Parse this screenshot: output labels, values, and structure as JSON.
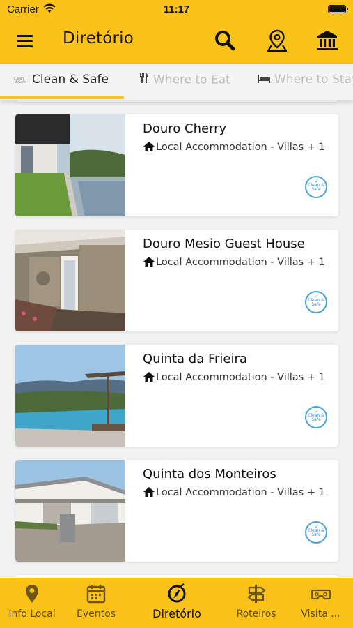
{
  "status": {
    "carrier": "Carrier",
    "time": "11:17"
  },
  "header": {
    "title": "Diretório"
  },
  "tabs": [
    {
      "label": "Clean & Safe",
      "active": true
    },
    {
      "label": "Where to Eat",
      "active": false
    },
    {
      "label": "Where to Stay",
      "active": false
    }
  ],
  "listings": [
    {
      "name": "Douro Cherry",
      "category": "Local Accommodation - Villas + 1",
      "badge": "Clean & Safe"
    },
    {
      "name": "Douro Mesio Guest House",
      "category": "Local Accommodation - Villas + 1",
      "badge": "Clean & Safe"
    },
    {
      "name": "Quinta da Frieira",
      "category": "Local Accommodation - Villas + 1",
      "badge": "Clean & Safe"
    },
    {
      "name": "Quinta dos Monteiros",
      "category": "Local Accommodation - Villas + 1",
      "badge": "Clean & Safe"
    }
  ],
  "bottom_nav": [
    {
      "label": "Info Local",
      "icon": "map-pin-icon",
      "active": false
    },
    {
      "label": "Eventos",
      "icon": "calendar-icon",
      "active": false
    },
    {
      "label": "Diretório",
      "icon": "compass-icon",
      "active": true
    },
    {
      "label": "Roteiros",
      "icon": "signpost-icon",
      "active": false
    },
    {
      "label": "Visita ...",
      "icon": "vr-headset-icon",
      "active": false
    }
  ],
  "colors": {
    "brand": "#fbc31a",
    "badge": "#4aa3d8"
  }
}
